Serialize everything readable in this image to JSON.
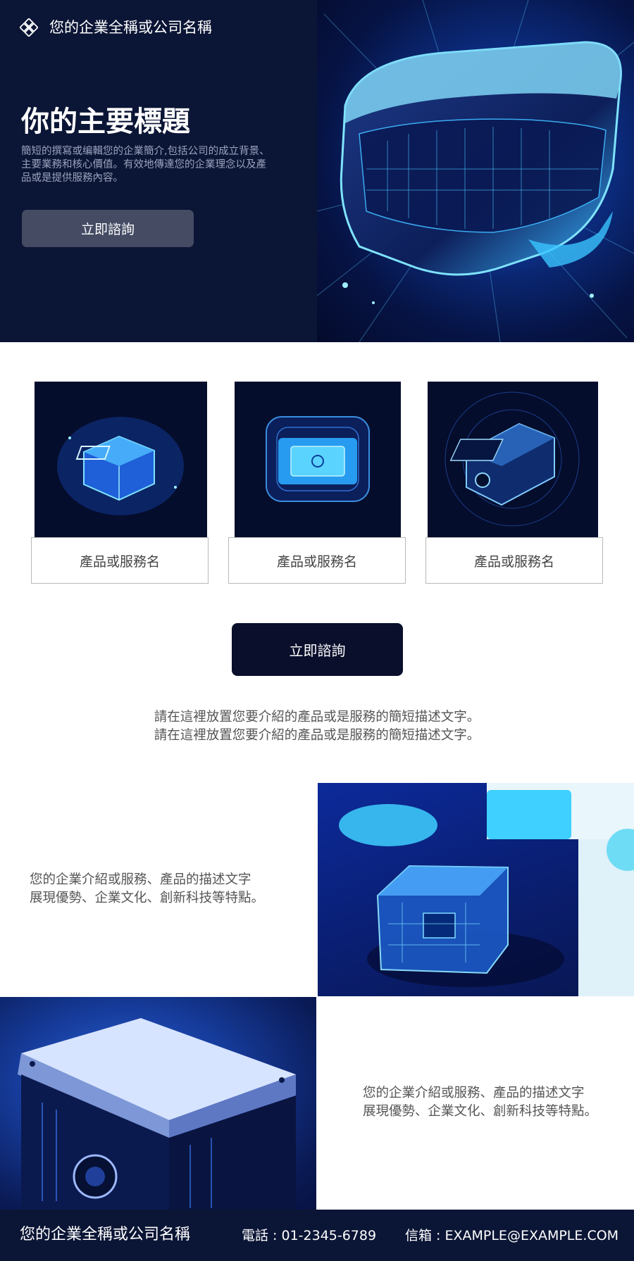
{
  "header": {
    "company_name": "您的企業全稱或公司名稱",
    "logo_icon": "diamond-knot-icon"
  },
  "hero": {
    "title": "你的主要標題",
    "description": "簡短的撰寫或编輯您的企業簡介,包括公司的成立背景、主要業務和核心價值。有效地傳達您的企業理念以及產品或是提供服務內容。",
    "button_label": "立即諮詢",
    "image": "vr-headset-image"
  },
  "products": {
    "items": [
      {
        "label": "產品或服務名",
        "image": "glowing-cube-chip-image"
      },
      {
        "label": "產品或服務名",
        "image": "glowing-square-chip-image"
      },
      {
        "label": "產品或服務名",
        "image": "camera-module-image"
      }
    ],
    "button_label": "立即諮詢",
    "intro_lines": [
      "請在這裡放置您要介紹的產品或是服務的簡短描述文字。",
      "請在這裡放置您要介紹的產品或是服務的簡短描述文字。"
    ]
  },
  "features": [
    {
      "lines": [
        "您的企業介紹或服務、產品的描述文字",
        "展現優勢、企業文化、創新科技等特點。"
      ],
      "image": "transparent-circuit-box-image"
    },
    {
      "lines": [
        "您的企業介紹或服務、產品的描述文字",
        "展現優勢、企業文化、創新科技等特點。"
      ],
      "image": "projector-device-image"
    }
  ],
  "footer": {
    "company_name": "您的企業全稱或公司名稱",
    "phone": "電話 : 01-2345-6789",
    "email": "信箱 : EXAMPLE@EXAMPLE.COM"
  },
  "colors": {
    "navy": "#0b1535",
    "button_dark": "#0a0f2c",
    "button_hero": "#444b63",
    "accent_blue": "#3fd0ff"
  }
}
